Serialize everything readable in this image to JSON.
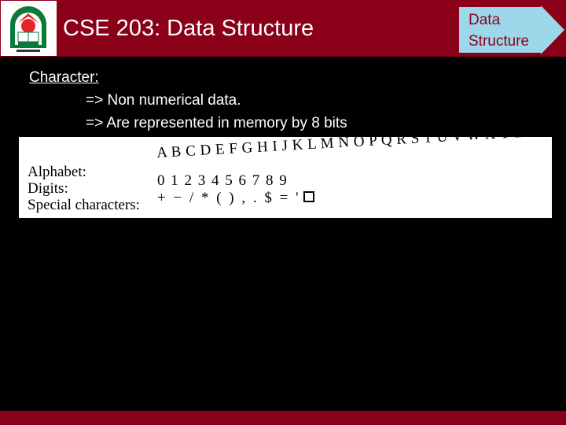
{
  "header": {
    "logo": "university-emblem",
    "title": "CSE 203: Data Structure",
    "badge_line1": "Data",
    "badge_line2": "Structure"
  },
  "colors": {
    "brand": "#8a0019",
    "badge_fill": "#9cd8ea",
    "background": "#000000"
  },
  "content": {
    "heading": "Character:",
    "bullets": [
      "=> Non numerical data.",
      "=> Are represented in memory by 8 bits"
    ]
  },
  "figure": {
    "labels": [
      "Alphabet:",
      "Digits:",
      "Special characters:"
    ],
    "alphabet": "A B C D E F G H I J K L M N O P Q R S T U V W X Y Z",
    "digits": "0 1 2 3 4 5 6 7 8 9",
    "special": "+ − / * ( ) , . $ = '",
    "special_extra": "blank-space-box"
  }
}
